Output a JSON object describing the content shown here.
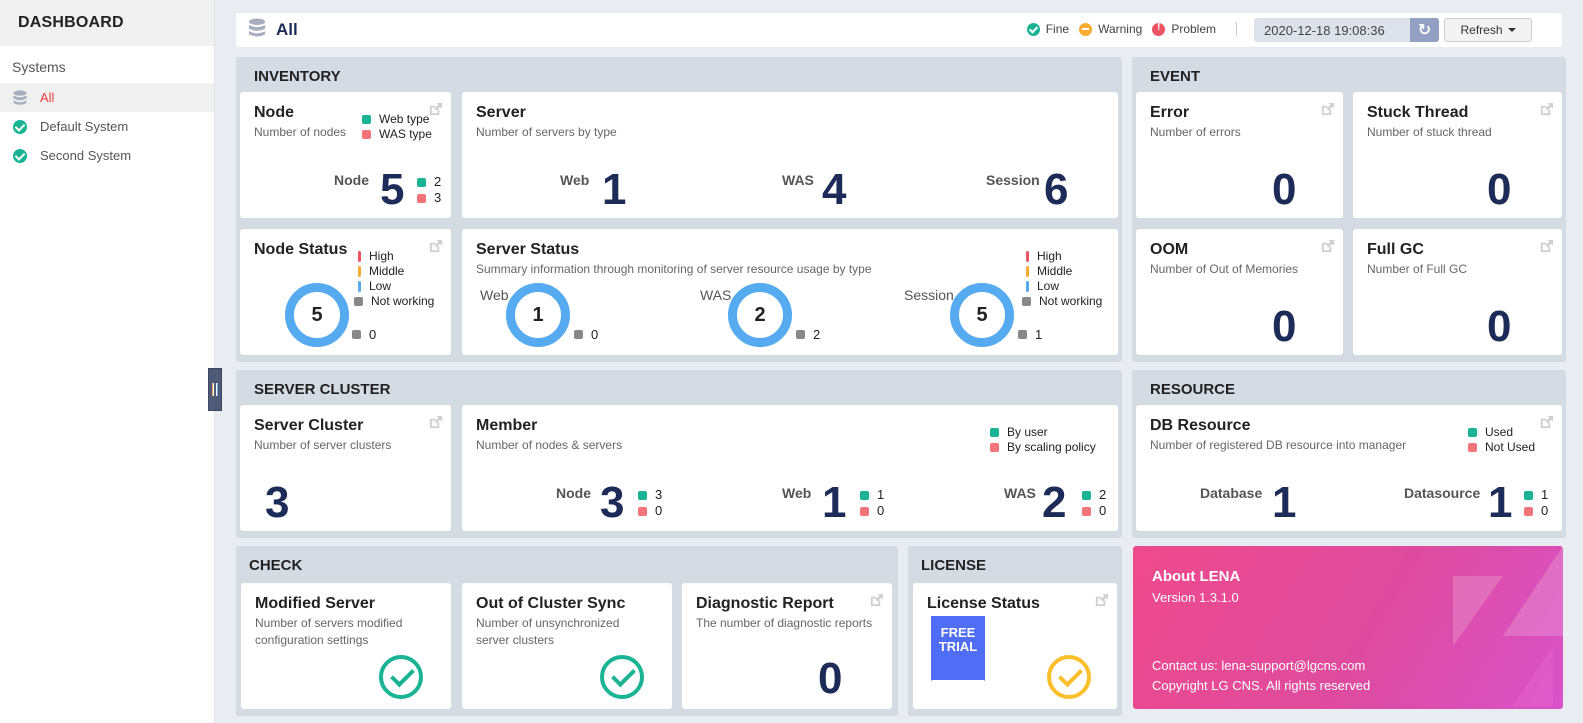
{
  "sidebar": {
    "title": "DASHBOARD",
    "section": "Systems",
    "items": [
      {
        "label": "All",
        "icon": "database-icon",
        "active": true
      },
      {
        "label": "Default System",
        "icon": "check-circle-icon",
        "active": false
      },
      {
        "label": "Second System",
        "icon": "check-circle-icon",
        "active": false
      }
    ]
  },
  "topbar": {
    "title": "All",
    "legend": {
      "fine": "Fine",
      "warning": "Warning",
      "problem": "Problem"
    },
    "datetime": "2020-12-18 19:08:36",
    "refresh_label": "Refresh"
  },
  "colors": {
    "fine": "#1ab394",
    "warning": "#f8ac30",
    "problem": "#ed5565",
    "low": "#55aaf0",
    "navy": "#1d2b59"
  },
  "inventory": {
    "title": "INVENTORY",
    "node": {
      "title": "Node",
      "subtitle": "Number of nodes",
      "legend": [
        "Web type",
        "WAS type"
      ],
      "label": "Node",
      "value": "5",
      "web": "2",
      "was": "3"
    },
    "server": {
      "title": "Server",
      "subtitle": "Number of servers by type",
      "items": [
        {
          "label": "Web",
          "value": "1"
        },
        {
          "label": "WAS",
          "value": "4"
        },
        {
          "label": "Session",
          "value": "6"
        }
      ]
    },
    "node_status": {
      "title": "Node Status",
      "legend": [
        "High",
        "Middle",
        "Low",
        "Not working"
      ],
      "value": "5",
      "not_working": "0"
    },
    "server_status": {
      "title": "Server Status",
      "subtitle": "Summary information through monitoring of server resource usage by type",
      "legend": [
        "High",
        "Middle",
        "Low",
        "Not working"
      ],
      "items": [
        {
          "label": "Web",
          "value": "1",
          "not_working": "0"
        },
        {
          "label": "WAS",
          "value": "2",
          "not_working": "2"
        },
        {
          "label": "Session",
          "value": "5",
          "not_working": "1"
        }
      ]
    }
  },
  "event": {
    "title": "EVENT",
    "cards": [
      {
        "title": "Error",
        "subtitle": "Number of errors",
        "value": "0"
      },
      {
        "title": "Stuck Thread",
        "subtitle": "Number of stuck thread",
        "value": "0"
      },
      {
        "title": "OOM",
        "subtitle": "Number of Out of Memories",
        "value": "0"
      },
      {
        "title": "Full GC",
        "subtitle": "Number of Full GC",
        "value": "0"
      }
    ]
  },
  "cluster": {
    "title": "SERVER CLUSTER",
    "server_cluster": {
      "title": "Server Cluster",
      "subtitle": "Number of server clusters",
      "value": "3"
    },
    "member": {
      "title": "Member",
      "subtitle": "Number of nodes & servers",
      "legend": [
        "By user",
        "By scaling policy"
      ],
      "items": [
        {
          "label": "Node",
          "value": "3",
          "by_user": "3",
          "by_policy": "0"
        },
        {
          "label": "Web",
          "value": "1",
          "by_user": "1",
          "by_policy": "0"
        },
        {
          "label": "WAS",
          "value": "2",
          "by_user": "2",
          "by_policy": "0"
        }
      ]
    }
  },
  "resource": {
    "title": "RESOURCE",
    "db": {
      "title": "DB Resource",
      "subtitle": "Number of registered DB resource into manager",
      "legend": [
        "Used",
        "Not Used"
      ],
      "database_label": "Database",
      "database_value": "1",
      "datasource_label": "Datasource",
      "datasource_value": "1",
      "used": "1",
      "not_used": "0"
    }
  },
  "check": {
    "title": "CHECK",
    "modified": {
      "title": "Modified Server",
      "subtitle": "Number of servers modified configuration settings",
      "status": "ok"
    },
    "sync": {
      "title": "Out of Cluster Sync",
      "subtitle": "Number of unsynchronized server clusters",
      "status": "ok"
    },
    "diag": {
      "title": "Diagnostic Report",
      "subtitle": "The number of diagnostic reports",
      "value": "0"
    }
  },
  "license": {
    "title": "LICENSE",
    "card_title": "License Status",
    "ribbon": "FREE TRIAL",
    "status": "warning-ok"
  },
  "about": {
    "title": "About LENA",
    "version": "Version 1.3.1.0",
    "contact": "Contact us: lena-support@lgcns.com",
    "copyright": "Copyright LG CNS. All rights reserved"
  }
}
